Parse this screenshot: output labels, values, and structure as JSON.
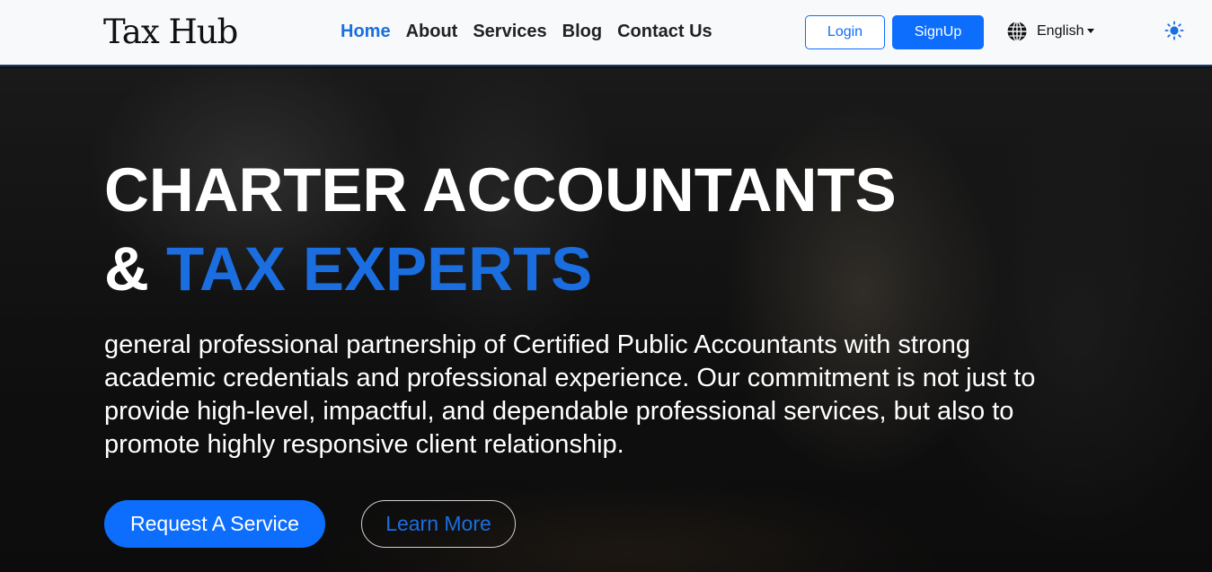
{
  "header": {
    "brand": "Tax Hub",
    "nav": [
      {
        "label": "Home",
        "active": true
      },
      {
        "label": "About",
        "active": false
      },
      {
        "label": "Services",
        "active": false
      },
      {
        "label": "Blog",
        "active": false
      },
      {
        "label": "Contact Us",
        "active": false
      }
    ],
    "login_label": "Login",
    "signup_label": "SignUp",
    "language": {
      "icon": "globe-icon",
      "selected": "English"
    },
    "theme_icon": "sun-icon"
  },
  "hero": {
    "title_line1": "CHARTER ACCOUNTANTS",
    "title_amp": "& ",
    "title_accent": "TAX EXPERTS",
    "description": "general professional partnership of Certified Public Accountants with strong academic credentials and professional experience. Our commitment is not just to provide high-level, impactful, and dependable professional services, but also to promote highly responsive client relationship.",
    "primary_button": "Request A Service",
    "secondary_button": "Learn More"
  },
  "colors": {
    "accent": "#0d6efd",
    "accent_text": "#1a6ee0",
    "header_bg": "#f8f9fa"
  }
}
